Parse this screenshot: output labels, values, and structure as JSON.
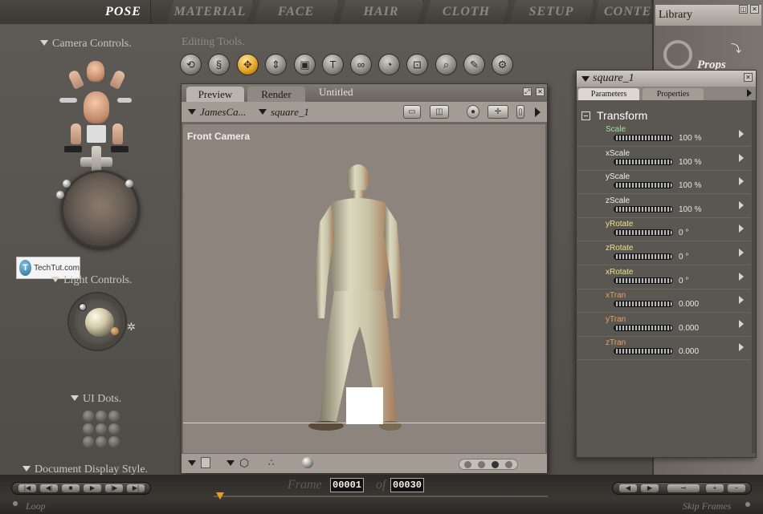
{
  "rooms": {
    "tabs": [
      {
        "label": "POSE",
        "active": true
      },
      {
        "label": "MATERIAL",
        "active": false
      },
      {
        "label": "FACE",
        "active": false
      },
      {
        "label": "HAIR",
        "active": false
      },
      {
        "label": "CLOTH",
        "active": false
      },
      {
        "label": "SETUP",
        "active": false
      },
      {
        "label": "CONTE",
        "active": false
      }
    ]
  },
  "left_panel": {
    "camera_controls": "Camera Controls.",
    "light_controls": "Light Controls.",
    "ui_dots": "UI Dots.",
    "document_display_style": "Document Display Style."
  },
  "watermark": {
    "logo_letter": "T",
    "text": "TechTut.com"
  },
  "editing_tools": {
    "label": "Editing Tools.",
    "tools": [
      {
        "icon": "rotate-icon",
        "glyph": "⟲"
      },
      {
        "icon": "twist-icon",
        "glyph": "§"
      },
      {
        "icon": "translate-icon",
        "glyph": "✥",
        "active": true
      },
      {
        "icon": "translate-in-out-icon",
        "glyph": "⇕"
      },
      {
        "icon": "scale-icon",
        "glyph": "▣"
      },
      {
        "icon": "taper-icon",
        "glyph": "T"
      },
      {
        "icon": "chain-break-icon",
        "glyph": "∞"
      },
      {
        "icon": "color-icon",
        "glyph": "◔"
      },
      {
        "icon": "grouping-icon",
        "glyph": "⊡"
      },
      {
        "icon": "view-magnifier-icon",
        "glyph": "⌕"
      },
      {
        "icon": "morphing-icon",
        "glyph": "✎"
      },
      {
        "icon": "direct-manipulation-icon",
        "glyph": "⚙"
      }
    ]
  },
  "preview": {
    "tabs": [
      "Preview",
      "Render"
    ],
    "document_title": "Untitled",
    "figure_selector": "JamesCa...",
    "actor_selector": "square_1",
    "camera_label": "Front Camera"
  },
  "parameters": {
    "title": "square_1",
    "tabs": [
      "Parameters",
      "Properties"
    ],
    "group": "Transform",
    "rows": [
      {
        "label": "Scale",
        "value": "100 %",
        "color": "#9fe0a0"
      },
      {
        "label": "xScale",
        "value": "100 %",
        "color": "#f0ece6"
      },
      {
        "label": "yScale",
        "value": "100 %",
        "color": "#f0ece6"
      },
      {
        "label": "zScale",
        "value": "100 %",
        "color": "#f0ece6"
      },
      {
        "label": "yRotate",
        "value": "0 °",
        "color": "#e8e088"
      },
      {
        "label": "zRotate",
        "value": "0 °",
        "color": "#e8e088"
      },
      {
        "label": "xRotate",
        "value": "0 °",
        "color": "#e8e088"
      },
      {
        "label": "xTran",
        "value": "0.000",
        "color": "#e8a060"
      },
      {
        "label": "yTran",
        "value": "0.000",
        "color": "#e8a060"
      },
      {
        "label": "zTran",
        "value": "0.000",
        "color": "#e8a060"
      }
    ]
  },
  "library": {
    "title": "Library",
    "category": "Props"
  },
  "animation": {
    "frame_label": "Frame",
    "current_frame": "00001",
    "of_label": "of",
    "total_frames": "00030",
    "loop_label": "Loop",
    "skip_frames_label": "Skip Frames"
  }
}
